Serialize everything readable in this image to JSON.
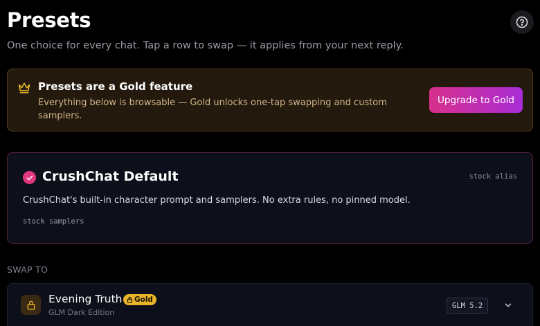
{
  "header": {
    "title": "Presets",
    "subtitle": "One choice for every chat. Tap a row to swap — it applies from your next reply.",
    "help_icon": "help-circle-icon"
  },
  "gold_banner": {
    "icon": "crown-icon",
    "title": "Presets are a Gold feature",
    "text": "Everything below is browsable — Gold unlocks one-tap swapping and custom samplers.",
    "upgrade_label": "Upgrade to Gold"
  },
  "current_preset": {
    "icon": "check-circle-icon",
    "name": "CrushChat Default",
    "alias": "stock alias",
    "description": "CrushChat's built-in character prompt and samplers. No extra rules, no pinned model.",
    "samplers": "stock samplers"
  },
  "swap_section": {
    "label": "SWAP TO",
    "items": [
      {
        "icon": "lock-icon",
        "name": "Evening Truth",
        "badge": "Gold",
        "subtitle": "GLM Dark Edition",
        "model": "GLM 5.2",
        "expand_icon": "chevron-down-icon"
      }
    ]
  },
  "colors": {
    "accent_pink": "#e0367f",
    "gold": "#e8b52a",
    "upgrade_gradient_start": "#d8308c",
    "upgrade_gradient_end": "#a82cd6"
  }
}
